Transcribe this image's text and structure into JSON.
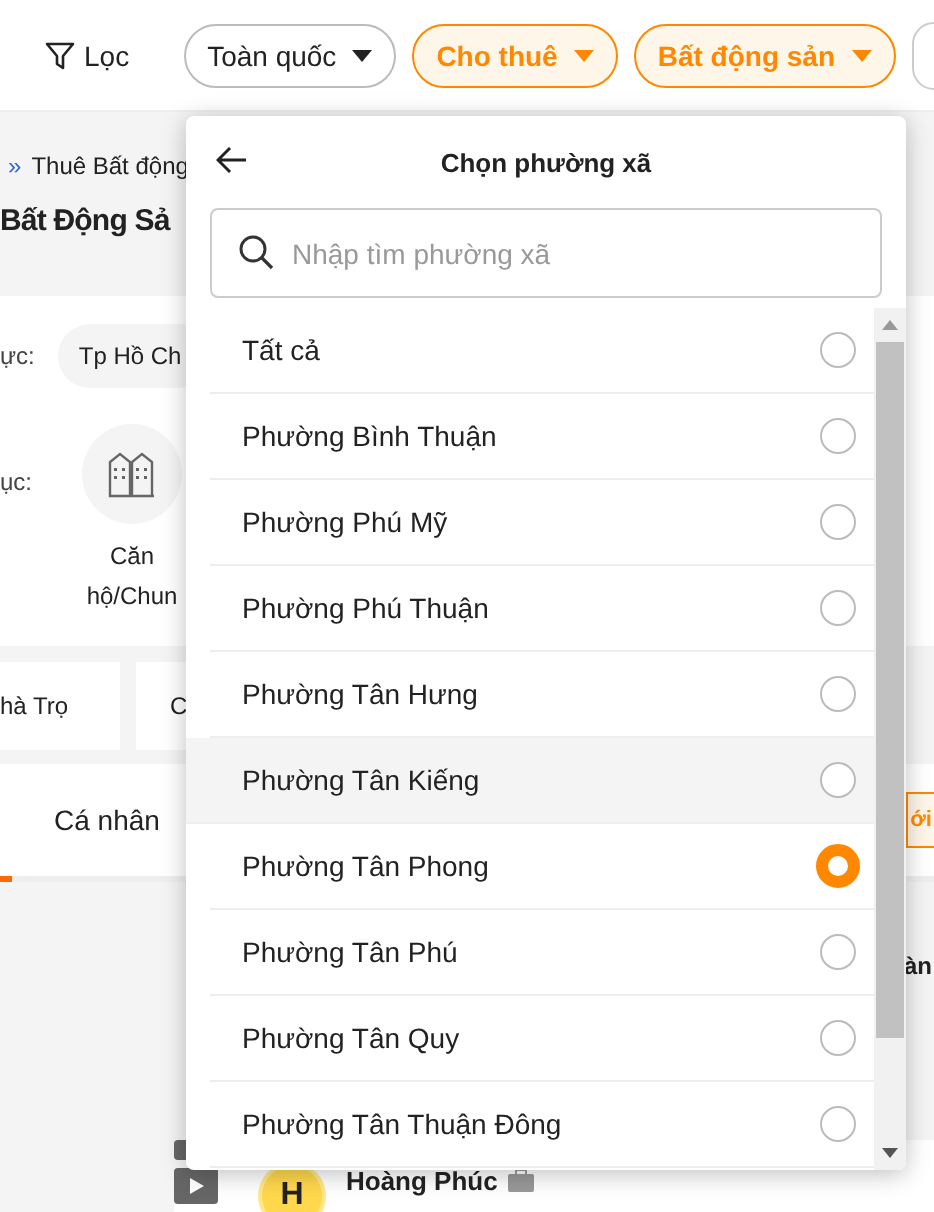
{
  "top_bar": {
    "filter_label": "Lọc",
    "chips": [
      {
        "label": "Toàn quốc",
        "selected": false
      },
      {
        "label": "Cho thuê",
        "selected": true
      },
      {
        "label": "Bất động sản",
        "selected": true
      }
    ]
  },
  "page": {
    "breadcrumb_separator": "»",
    "breadcrumb": "Thuê Bất động",
    "title": "Bất Động Sả",
    "area_label": "ực:",
    "area_chip": "Tp Hồ Ch",
    "category_label": "ục:",
    "category_name": "Căn hộ/Chun",
    "cards": [
      "hà Trọ",
      "C"
    ],
    "tab": "Cá nhân",
    "right_button": "ới",
    "right_text": "àn",
    "seller_initial": "H",
    "seller_name": "Hoàng Phúc"
  },
  "modal": {
    "title": "Chọn phường xã",
    "search": {
      "placeholder": "Nhập tìm phường xã"
    },
    "options": [
      {
        "label": "Tất cả",
        "selected": false,
        "highlighted": false
      },
      {
        "label": "Phường Bình Thuận",
        "selected": false,
        "highlighted": false
      },
      {
        "label": "Phường Phú Mỹ",
        "selected": false,
        "highlighted": false
      },
      {
        "label": "Phường Phú Thuận",
        "selected": false,
        "highlighted": false
      },
      {
        "label": "Phường Tân Hưng",
        "selected": false,
        "highlighted": false
      },
      {
        "label": "Phường Tân Kiếng",
        "selected": false,
        "highlighted": true
      },
      {
        "label": "Phường Tân Phong",
        "selected": true,
        "highlighted": false
      },
      {
        "label": "Phường Tân Phú",
        "selected": false,
        "highlighted": false
      },
      {
        "label": "Phường Tân Quy",
        "selected": false,
        "highlighted": false
      },
      {
        "label": "Phường Tân Thuận Đông",
        "selected": false,
        "highlighted": false
      }
    ]
  }
}
